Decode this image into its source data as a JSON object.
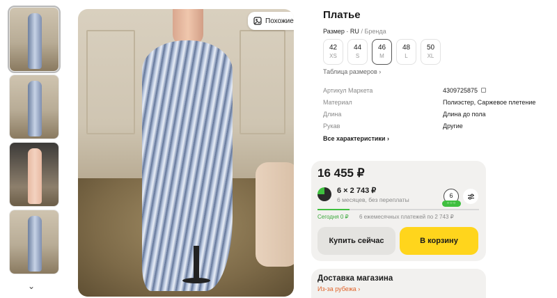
{
  "gallery": {
    "similar_label": "Похожие",
    "more_arrow": "⌄",
    "thumbnail_count": 4
  },
  "product": {
    "title": "Платье",
    "size_system": "Размер · RU",
    "size_brand": " / Бренда",
    "sizes": [
      {
        "num": "42",
        "letter": "XS",
        "selected": false
      },
      {
        "num": "44",
        "letter": "S",
        "selected": false
      },
      {
        "num": "46",
        "letter": "M",
        "selected": true
      },
      {
        "num": "48",
        "letter": "L",
        "selected": false
      },
      {
        "num": "50",
        "letter": "XL",
        "selected": false
      }
    ],
    "size_table_link": "Таблица размеров ›",
    "properties": [
      {
        "key": "Артикул Маркета",
        "value": "4309725875"
      },
      {
        "key": "Материал",
        "value": "Полиэстер, Саржевое плетение"
      },
      {
        "key": "Длина",
        "value": "Длина до пола"
      },
      {
        "key": "Рукав",
        "value": "Другие"
      }
    ],
    "all_properties_link": "Все характеристики ›"
  },
  "offer": {
    "price": "16 455 ₽",
    "split_amount": "6 × 2 743 ₽",
    "split_terms": "6 месяцев, без переплаты",
    "split_badge": "6",
    "split_badge_dots": "○○○",
    "paid_fraction": 0.2,
    "today_label": "Сегодня 0 ₽",
    "monthly_label": "6 ежемесячных платежей по 2 743 ₽",
    "buy_now_label": "Купить сейчас",
    "to_cart_label": "В корзину",
    "accent_color": "#ffd51c",
    "split_color": "#3fbf3f"
  },
  "delivery": {
    "title": "Доставка магазина",
    "subtitle": "Из-за рубежа ›"
  }
}
